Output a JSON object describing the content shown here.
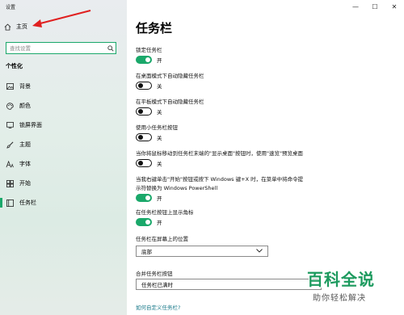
{
  "app_title": "设置",
  "window_controls": [
    "—",
    "☐",
    "✕"
  ],
  "sidebar": {
    "home_label": "主页",
    "search_placeholder": "查找设置",
    "section_title": "个性化",
    "items": [
      {
        "label": "背景",
        "icon": "image-icon"
      },
      {
        "label": "颜色",
        "icon": "palette-icon"
      },
      {
        "label": "锁屏界面",
        "icon": "lock-screen-icon"
      },
      {
        "label": "主题",
        "icon": "brush-icon"
      },
      {
        "label": "字体",
        "icon": "font-icon"
      },
      {
        "label": "开始",
        "icon": "start-icon"
      },
      {
        "label": "任务栏",
        "icon": "taskbar-icon",
        "active": true
      }
    ]
  },
  "main": {
    "title": "任务栏",
    "settings": [
      {
        "label": "锁定任务栏",
        "state": "开",
        "on": true
      },
      {
        "label": "在桌面模式下自动隐藏任务栏",
        "state": "关",
        "on": false
      },
      {
        "label": "在平板模式下自动隐藏任务栏",
        "state": "关",
        "on": false
      },
      {
        "label": "使用小任务栏按钮",
        "state": "关",
        "on": false
      },
      {
        "label": "当你将鼠标移动到任务栏末端的\"显示桌面\"按钮时，使用\"速览\"预览桌面",
        "state": "关",
        "on": false
      },
      {
        "label": "当我右键单击\"开始\"按钮或按下 Windows 键+X 时，在菜单中将命令提",
        "label2": "示符替换为 Windows PowerShell",
        "state": "开",
        "on": true
      },
      {
        "label": "在任务栏按钮上显示角标",
        "state": "开",
        "on": true
      }
    ],
    "position_label": "任务栏在屏幕上的位置",
    "position_value": "底部",
    "combine_label": "合并任务栏按钮",
    "combine_value": "任务栏已满时",
    "customize_link": "如何自定义任务栏?"
  },
  "watermark": {
    "title": "百科全说",
    "subtitle": "助你轻松解决"
  },
  "colors": {
    "accent": "#1aa86a",
    "annotation": "#e02020"
  }
}
